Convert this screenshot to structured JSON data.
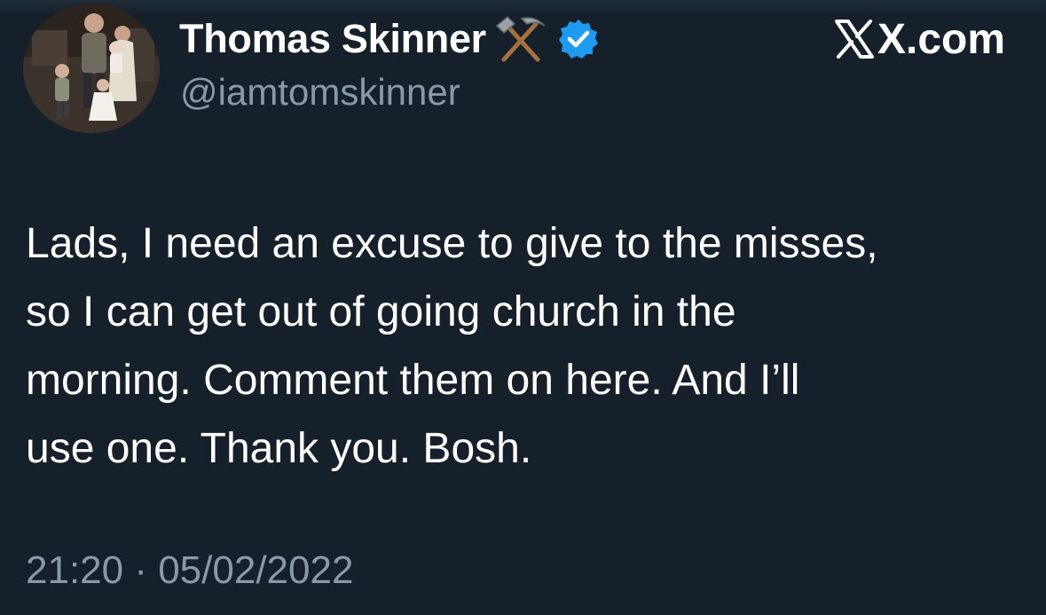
{
  "author": {
    "display_name": "Thomas Skinner",
    "name_emoji_icon": "hammer-and-pick-icon",
    "verified_icon": "verified-badge-icon",
    "handle": "@iamtomskinner"
  },
  "brand": {
    "icon": "x-logo-icon",
    "label": "X.com"
  },
  "tweet": {
    "lines": [
      "Lads, I need an excuse to give to the misses,",
      "so I can get out of going church in the",
      "morning. Comment them on here. And I’ll",
      "use one. Thank you. Bosh."
    ],
    "timestamp": "21:20 · 05/02/2022"
  },
  "colors": {
    "background": "#15202b",
    "text_primary": "#ffffff",
    "text_secondary": "#8b98a5",
    "verified_blue": "#1d9bf0"
  }
}
